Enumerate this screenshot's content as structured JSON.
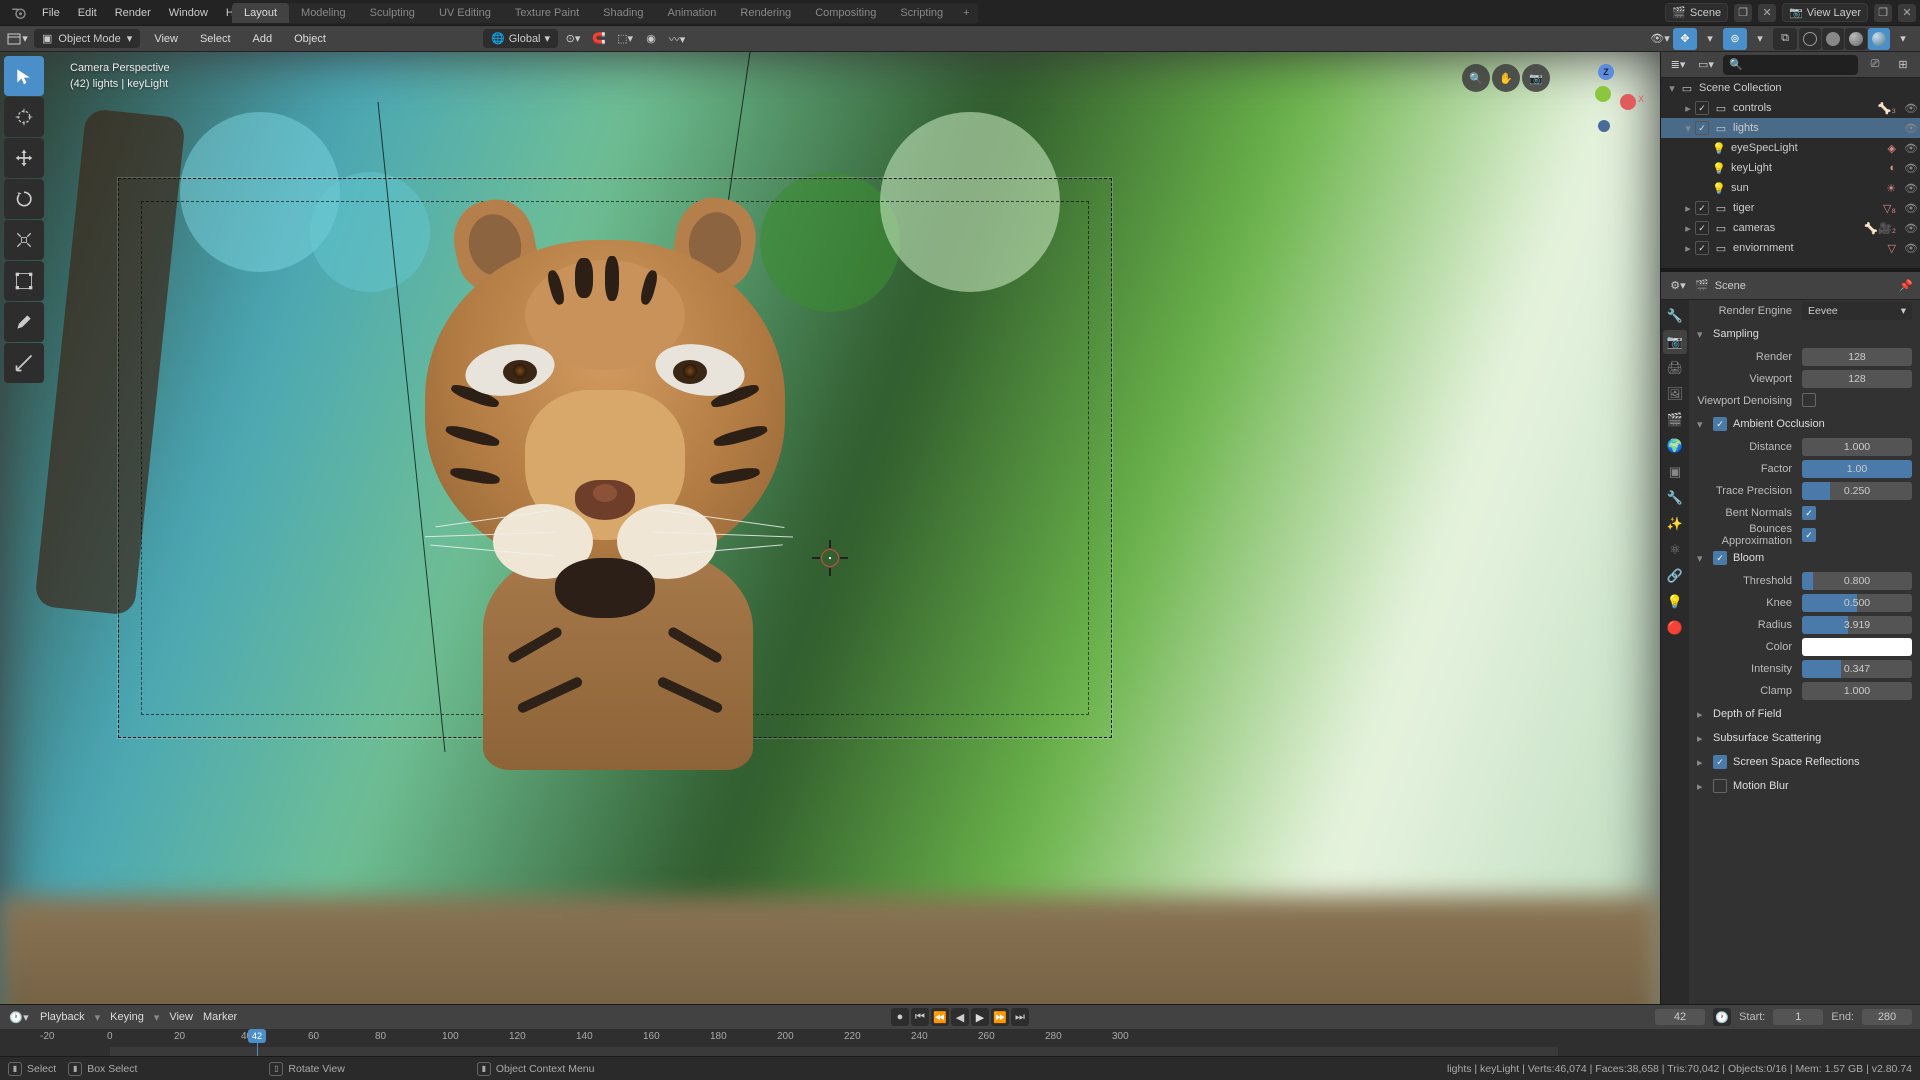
{
  "top_menu": {
    "items": [
      "File",
      "Edit",
      "Render",
      "Window",
      "Help"
    ]
  },
  "workspace_tabs": [
    "Layout",
    "Modeling",
    "Sculpting",
    "UV Editing",
    "Texture Paint",
    "Shading",
    "Animation",
    "Rendering",
    "Compositing",
    "Scripting"
  ],
  "workspace_active": "Layout",
  "scene_name": "Scene",
  "view_layer_name": "View Layer",
  "header": {
    "mode": "Object Mode",
    "menus": [
      "View",
      "Select",
      "Add",
      "Object"
    ],
    "orientation": "Global"
  },
  "viewport_overlay": {
    "line1": "Camera Perspective",
    "line2": "(42) lights | keyLight"
  },
  "gizmo_axes": {
    "x": "X",
    "y": "",
    "z": "Z"
  },
  "outliner": {
    "root": "Scene Collection",
    "items": [
      {
        "name": "controls",
        "type": "collection",
        "indent": 1,
        "expanded": false,
        "checked": true,
        "badge": "🦴₃",
        "visible": true
      },
      {
        "name": "lights",
        "type": "collection",
        "indent": 1,
        "expanded": true,
        "checked": true,
        "selected": true,
        "visible": true
      },
      {
        "name": "eyeSpecLight",
        "type": "light",
        "indent": 2,
        "icon": "💡",
        "badge": "◈",
        "visible": true
      },
      {
        "name": "keyLight",
        "type": "light",
        "indent": 2,
        "icon": "💡",
        "badge": "◐",
        "visible": true
      },
      {
        "name": "sun",
        "type": "light",
        "indent": 2,
        "icon": "💡",
        "badge": "☀",
        "visible": true
      },
      {
        "name": "tiger",
        "type": "collection",
        "indent": 1,
        "expanded": false,
        "checked": true,
        "badge": "▽₈",
        "visible": true
      },
      {
        "name": "cameras",
        "type": "collection",
        "indent": 1,
        "expanded": false,
        "checked": true,
        "badge": "🦴🎥₂",
        "visible": true
      },
      {
        "name": "enviornment",
        "type": "collection",
        "indent": 1,
        "expanded": false,
        "checked": true,
        "badge": "▽",
        "visible": true
      }
    ]
  },
  "properties": {
    "context": "Scene",
    "render_engine_label": "Render Engine",
    "render_engine": "Eevee",
    "panels": {
      "sampling": {
        "title": "Sampling",
        "render_label": "Render",
        "render": "128",
        "viewport_label": "Viewport",
        "viewport": "128",
        "vpd_label": "Viewport Denoising",
        "vpd": false
      },
      "ao": {
        "title": "Ambient Occlusion",
        "enabled": true,
        "distance_label": "Distance",
        "distance": "1.000",
        "factor_label": "Factor",
        "factor": "1.00",
        "factor_fill": 100,
        "trace_label": "Trace Precision",
        "trace": "0.250",
        "trace_fill": 25,
        "bent_label": "Bent Normals",
        "bent": true,
        "bounces_label": "Bounces Approximation",
        "bounces": true
      },
      "bloom": {
        "title": "Bloom",
        "enabled": true,
        "threshold_label": "Threshold",
        "threshold": "0.800",
        "threshold_fill": 10,
        "knee_label": "Knee",
        "knee": "0.500",
        "knee_fill": 50,
        "radius_label": "Radius",
        "radius": "3.919",
        "radius_fill": 42,
        "color_label": "Color",
        "intensity_label": "Intensity",
        "intensity": "0.347",
        "intensity_fill": 35,
        "clamp_label": "Clamp",
        "clamp": "1.000"
      },
      "dof": {
        "title": "Depth of Field"
      },
      "sss": {
        "title": "Subsurface Scattering"
      },
      "ssr": {
        "title": "Screen Space Reflections",
        "enabled": true
      },
      "mb": {
        "title": "Motion Blur",
        "enabled": false
      }
    }
  },
  "timeline": {
    "menus": [
      "Playback",
      "Keying",
      "View",
      "Marker"
    ],
    "current": "42",
    "start_label": "Start:",
    "start": "1",
    "end_label": "End:",
    "end": "280",
    "ticks": [
      -20,
      0,
      20,
      40,
      60,
      80,
      100,
      120,
      140,
      160,
      180,
      200,
      220,
      240,
      260,
      280,
      300
    ]
  },
  "status": {
    "select": "Select",
    "box": "Box Select",
    "rotate": "Rotate View",
    "context": "Object Context Menu",
    "right": "lights | keyLight | Verts:46,074 | Faces:38,658 | Tris:70,042 | Objects:0/16 | Mem: 1.57 GB | v2.80.74"
  }
}
